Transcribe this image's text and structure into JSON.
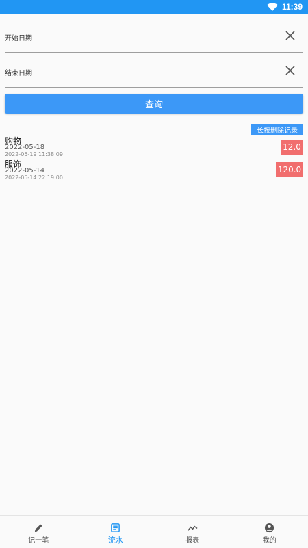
{
  "status_bar": {
    "time": "11:39"
  },
  "filters": {
    "start_label": "开始日期",
    "end_label": "结束日期"
  },
  "query_button": "查询",
  "hint_badge": "长按删除记录",
  "records": [
    {
      "category": "购物",
      "date": "2022-05-18",
      "created": "2022-05-19 11:38:09",
      "amount": "12.0"
    },
    {
      "category": "服饰",
      "date": "2022-05-14",
      "created": "2022-05-14 22:19:00",
      "amount": "120.0"
    }
  ],
  "nav": {
    "items": [
      {
        "label": "记一笔",
        "icon": "pencil-icon"
      },
      {
        "label": "流水",
        "icon": "list-icon",
        "active": true
      },
      {
        "label": "报表",
        "icon": "trend-icon"
      },
      {
        "label": "我的",
        "icon": "account-icon"
      }
    ]
  },
  "colors": {
    "primary": "#2196f3",
    "button": "#3c98f7",
    "amount": "#f16e6e"
  }
}
